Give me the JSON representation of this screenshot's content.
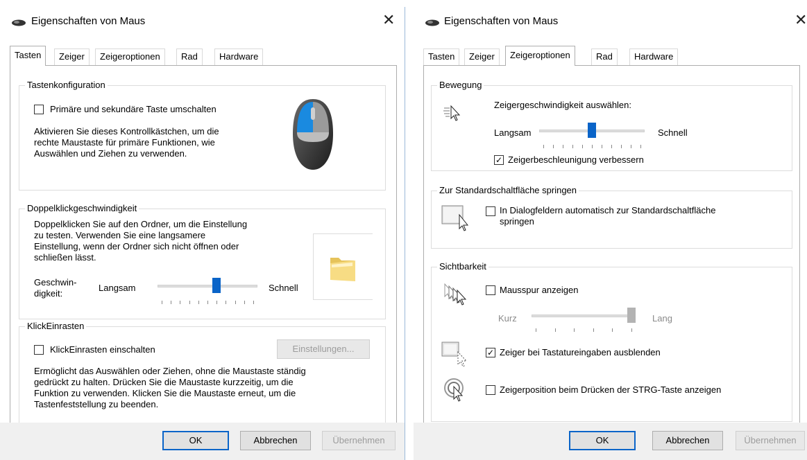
{
  "left": {
    "title": "Eigenschaften von Maus",
    "close_glyph": "✕",
    "tabs": [
      "Tasten",
      "Zeiger",
      "Zeigeroptionen",
      "Rad",
      "Hardware"
    ],
    "active_tab": "Tasten",
    "buttons_config": {
      "group_title": "Tastenkonfiguration",
      "checkbox_label": "Primäre und sekundäre Taste umschalten",
      "checked": false,
      "description": [
        "Aktivieren Sie dieses Kontrollkästchen, um die",
        "rechte Maustaste für primäre Funktionen, wie",
        "Auswählen und Ziehen zu verwenden."
      ]
    },
    "double_click": {
      "group_title": "Doppelklickgeschwindigkeit",
      "description": [
        "Doppelklicken Sie auf den Ordner, um die Einstellung",
        "zu testen. Verwenden Sie eine langsamere",
        "Einstellung, wenn der Ordner sich nicht öffnen oder",
        "schließen lässt."
      ],
      "label_speed": [
        "Geschwin-",
        "digkeit:"
      ],
      "slow": "Langsam",
      "fast": "Schnell",
      "slider_value": 0.6
    },
    "click_lock": {
      "group_title": "KlickEinrasten",
      "checkbox_label": "KlickEinrasten einschalten",
      "checked": false,
      "settings_button": "Einstellungen...",
      "description": [
        "Ermöglicht das Auswählen oder Ziehen, ohne die Maustaste ständig",
        "gedrückt zu halten. Drücken Sie die Maustaste kurzzeitig, um die",
        "Funktion zu verwenden. Klicken Sie die Maustaste erneut, um die",
        "Tastenfeststellung zu beenden."
      ]
    },
    "footer": {
      "ok": "OK",
      "cancel": "Abbrechen",
      "apply": "Übernehmen"
    }
  },
  "right": {
    "title": "Eigenschaften von Maus",
    "close_glyph": "✕",
    "tabs": [
      "Tasten",
      "Zeiger",
      "Zeigeroptionen",
      "Rad",
      "Hardware"
    ],
    "active_tab": "Zeigeroptionen",
    "motion": {
      "group_title": "Bewegung",
      "label": "Zeigergeschwindigkeit auswählen:",
      "slow": "Langsam",
      "fast": "Schnell",
      "slider_value": 0.5,
      "enhance_label": "Zeigerbeschleunigung verbessern",
      "enhance_checked": true
    },
    "snap_to": {
      "group_title": "Zur Standardschaltfläche springen",
      "checkbox_label": [
        "In Dialogfeldern automatisch zur Standardschaltfläche",
        "springen"
      ],
      "checked": false
    },
    "visibility": {
      "group_title": "Sichtbarkeit",
      "trails_label": "Mausspur anzeigen",
      "trails_checked": false,
      "short": "Kurz",
      "long": "Lang",
      "trails_value": 1.0,
      "hide_label": "Zeiger bei Tastatureingaben ausblenden",
      "hide_checked": true,
      "ctrl_label": "Zeigerposition beim Drücken der STRG-Taste anzeigen",
      "ctrl_checked": false
    },
    "footer": {
      "ok": "OK",
      "cancel": "Abbrechen",
      "apply": "Übernehmen"
    }
  },
  "colors": {
    "accent": "#0a64c8",
    "dialog_border": "#9ab8d8",
    "footer_bg": "#f0f0f0"
  }
}
